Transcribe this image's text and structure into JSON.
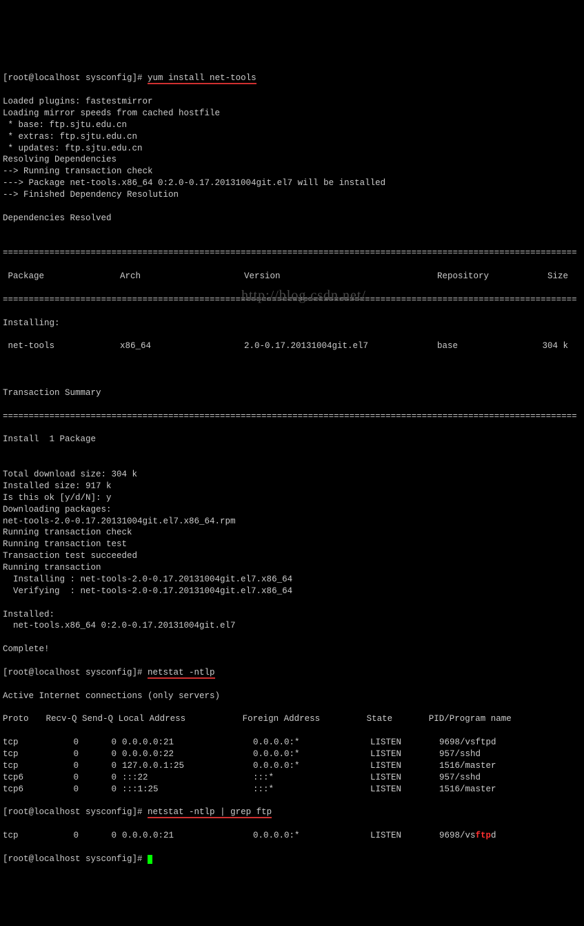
{
  "prompt1_prefix": "[root@localhost sysconfig]# ",
  "prompt1_cmd": "yum install net-tools",
  "lines_yum1": [
    "Loaded plugins: fastestmirror",
    "Loading mirror speeds from cached hostfile",
    " * base: ftp.sjtu.edu.cn",
    " * extras: ftp.sjtu.edu.cn",
    " * updates: ftp.sjtu.edu.cn",
    "Resolving Dependencies",
    "--> Running transaction check",
    "---> Package net-tools.x86_64 0:2.0-0.17.20131004git.el7 will be installed",
    "--> Finished Dependency Resolution",
    "",
    "Dependencies Resolved",
    ""
  ],
  "hr": "===============================================================================================================",
  "hdr": {
    "pkg": " Package",
    "arch": "Arch",
    "ver": "Version",
    "repo": "Repository",
    "size": "Size"
  },
  "install_label": "Installing:",
  "pkg_row": {
    "pkg": " net-tools",
    "arch": "x86_64",
    "ver": "2.0-0.17.20131004git.el7",
    "repo": "base",
    "size": "304 k"
  },
  "tx_summary": "Transaction Summary",
  "install_count": "Install  1 Package",
  "lines_yum2": [
    "",
    "Total download size: 304 k",
    "Installed size: 917 k",
    "Is this ok [y/d/N]: y",
    "Downloading packages:",
    "net-tools-2.0-0.17.20131004git.el7.x86_64.rpm",
    "Running transaction check",
    "Running transaction test",
    "Transaction test succeeded",
    "Running transaction",
    "  Installing : net-tools-2.0-0.17.20131004git.el7.x86_64",
    "  Verifying  : net-tools-2.0-0.17.20131004git.el7.x86_64",
    "",
    "Installed:",
    "  net-tools.x86_64 0:2.0-0.17.20131004git.el7",
    "",
    "Complete!"
  ],
  "prompt2_prefix": "[root@localhost sysconfig]# ",
  "prompt2_cmd": "netstat -ntlp",
  "net_hdr1": "Active Internet connections (only servers)",
  "net_cols": {
    "proto": "Proto",
    "recv": "Recv-Q",
    "send": "Send-Q",
    "local": "Local Address",
    "foreign": "Foreign Address",
    "state": "State",
    "pid": "PID/Program name"
  },
  "net_rows": [
    {
      "proto": "tcp",
      "recv": "0",
      "send": "0",
      "local": "0.0.0.0:21",
      "foreign": "0.0.0.0:*",
      "state": "LISTEN",
      "pid": "9698/vsftpd"
    },
    {
      "proto": "tcp",
      "recv": "0",
      "send": "0",
      "local": "0.0.0.0:22",
      "foreign": "0.0.0.0:*",
      "state": "LISTEN",
      "pid": "957/sshd"
    },
    {
      "proto": "tcp",
      "recv": "0",
      "send": "0",
      "local": "127.0.0.1:25",
      "foreign": "0.0.0.0:*",
      "state": "LISTEN",
      "pid": "1516/master"
    },
    {
      "proto": "tcp6",
      "recv": "0",
      "send": "0",
      "local": ":::22",
      "foreign": ":::*",
      "state": "LISTEN",
      "pid": "957/sshd"
    },
    {
      "proto": "tcp6",
      "recv": "0",
      "send": "0",
      "local": ":::1:25",
      "foreign": ":::*",
      "state": "LISTEN",
      "pid": "1516/master"
    }
  ],
  "prompt3_prefix": "[root@localhost sysconfig]# ",
  "prompt3_cmd": "netstat -ntlp | grep ftp",
  "grep_row": {
    "proto": "tcp",
    "recv": "0",
    "send": "0",
    "local": "0.0.0.0:21",
    "foreign": "0.0.0.0:*",
    "state": "LISTEN",
    "pid_a": "9698/vs",
    "pid_b": "ftp",
    "pid_c": "d"
  },
  "prompt4_prefix": "[root@localhost sysconfig]# ",
  "watermark": "http://blog.csdn.net/"
}
